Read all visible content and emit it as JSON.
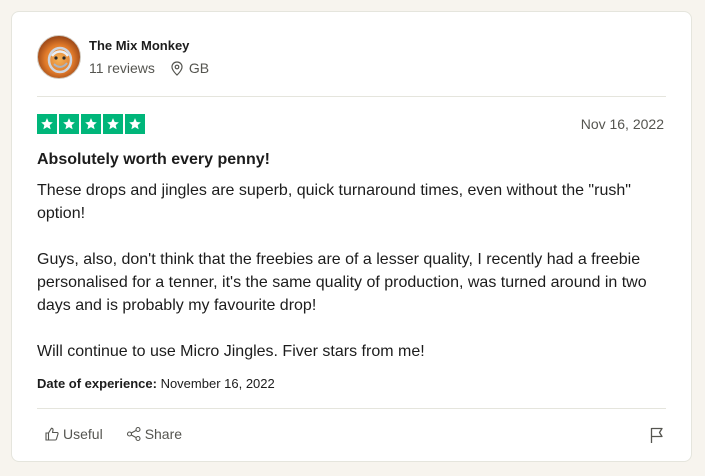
{
  "reviewer": {
    "name": "The Mix Monkey",
    "reviews": "11 reviews",
    "country": "GB",
    "avatar_icon": "monkey-logo-avatar"
  },
  "rating": {
    "stars": 5,
    "max": 5,
    "color": "#00b67a"
  },
  "review": {
    "date": "Nov 16, 2022",
    "title": "Absolutely worth every penny!",
    "body": "These drops and jingles are superb, quick turnaround times, even without the \"rush\" option!\n\nGuys, also, don't think that the freebies are of a lesser quality, I recently had a freebie personalised for a tenner, it's the same quality of production, was turned around in two days and is probably my favourite drop!\n\nWill continue to use Micro Jingles. Fiver stars from me!",
    "experience_label": "Date of experience:",
    "experience_date": "November 16, 2022"
  },
  "actions": {
    "useful_label": "Useful",
    "share_label": "Share",
    "useful_icon": "thumbs-up-icon",
    "share_icon": "share-icon",
    "flag_icon": "flag-icon"
  }
}
